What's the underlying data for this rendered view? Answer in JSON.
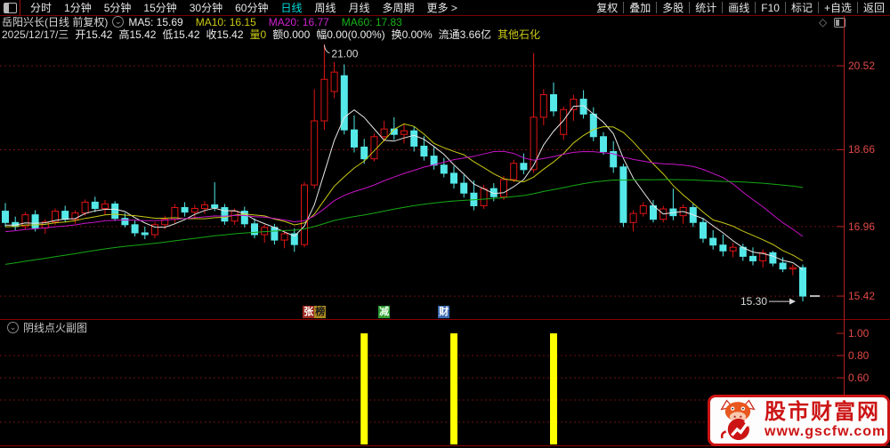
{
  "menubar": {
    "items": [
      "分时",
      "1分钟",
      "5分钟",
      "15分钟",
      "30分钟",
      "60分钟",
      "日线",
      "周线",
      "月线",
      "多周期",
      "更多 >"
    ],
    "active_item": "日线",
    "right_items": [
      "复权",
      "叠加",
      "多股",
      "统计",
      "画线",
      "F10",
      "标记",
      "+自选",
      "返回"
    ]
  },
  "info_bar": {
    "title": "岳阳兴长(日线 前复权)",
    "ma_legend": [
      {
        "label": "MA5: 15.69",
        "color": "#ececec"
      },
      {
        "label": "MA10: 16.15",
        "color": "#c9c914"
      },
      {
        "label": "MA20: 16.77",
        "color": "#d023d0"
      },
      {
        "label": "MA60: 17.83",
        "color": "#17b317"
      }
    ]
  },
  "quote_bar": {
    "fields": [
      {
        "text": "2025/12/17/三",
        "color": "#d9d9d9"
      },
      {
        "text": "开15.42",
        "color": "#ececec"
      },
      {
        "text": "高15.42",
        "color": "#ececec"
      },
      {
        "text": "低15.42",
        "color": "#ececec"
      },
      {
        "text": "收15.42",
        "color": "#ececec"
      },
      {
        "text": "量0",
        "color": "#c9c914"
      },
      {
        "text": "额0.000",
        "color": "#ececec"
      },
      {
        "text": "幅0.00(0.00%)",
        "color": "#ececec"
      },
      {
        "text": "换0.00%",
        "color": "#ececec"
      },
      {
        "text": "流通3.66亿",
        "color": "#ececec"
      },
      {
        "text": "其他石化",
        "color": "#c9c914"
      }
    ]
  },
  "chart_data": {
    "type": "candlestick",
    "price_ticks": [
      20.52,
      18.66,
      16.96,
      15.42
    ],
    "colors": {
      "up": "#e01414",
      "down": "#55e8e8",
      "grid": "#701010",
      "axis_text": "#e04848",
      "axis_line": "#b42222",
      "ma": [
        "#e8e8e8",
        "#c9c914",
        "#c714c7",
        "#15a815"
      ],
      "signal_bar": "#ffff00",
      "annotation": "#d8d8d8"
    },
    "ma_lines": [
      {
        "period": 5
      },
      {
        "period": 10
      },
      {
        "period": 20
      },
      {
        "period": 60
      }
    ],
    "ma_context_closes": [
      14.9,
      14.95,
      15.0,
      15.05,
      15.1,
      15.14,
      15.18,
      15.22,
      15.26,
      15.3,
      15.34,
      15.38,
      15.42,
      15.46,
      15.5,
      15.54,
      15.58,
      15.62,
      15.66,
      15.7,
      15.74,
      15.78,
      15.82,
      15.86,
      15.9,
      15.94,
      15.98,
      16.02,
      16.06,
      16.1,
      16.14,
      16.18,
      16.22,
      16.26,
      16.3,
      16.34,
      16.38,
      16.42,
      16.46,
      16.5,
      16.54,
      16.58,
      16.62,
      16.66,
      16.7,
      16.74,
      16.78,
      16.8,
      16.82,
      16.84,
      16.86,
      16.88,
      16.9,
      16.92,
      16.94,
      16.95,
      16.96,
      16.97,
      16.98,
      17.0
    ],
    "candles": [
      [
        17.3,
        17.48,
        16.95,
        17.05
      ],
      [
        17.05,
        17.18,
        16.88,
        16.96
      ],
      [
        16.96,
        17.28,
        16.9,
        17.22
      ],
      [
        17.22,
        17.32,
        16.85,
        16.93
      ],
      [
        16.93,
        17.12,
        16.8,
        17.06
      ],
      [
        17.06,
        17.36,
        17.0,
        17.3
      ],
      [
        17.3,
        17.42,
        17.06,
        17.12
      ],
      [
        17.12,
        17.32,
        17.02,
        17.26
      ],
      [
        17.26,
        17.56,
        17.2,
        17.5
      ],
      [
        17.5,
        17.62,
        17.28,
        17.36
      ],
      [
        17.36,
        17.55,
        17.22,
        17.46
      ],
      [
        17.46,
        17.52,
        17.08,
        17.14
      ],
      [
        17.14,
        17.26,
        16.94,
        17.0
      ],
      [
        17.0,
        17.1,
        16.74,
        16.82
      ],
      [
        16.82,
        16.96,
        16.68,
        16.78
      ],
      [
        16.78,
        17.06,
        16.7,
        17.0
      ],
      [
        17.0,
        17.2,
        16.9,
        17.12
      ],
      [
        17.12,
        17.46,
        17.04,
        17.38
      ],
      [
        17.38,
        17.5,
        17.18,
        17.28
      ],
      [
        17.28,
        17.44,
        17.14,
        17.36
      ],
      [
        17.36,
        17.52,
        17.24,
        17.44
      ],
      [
        17.44,
        17.94,
        17.3,
        17.38
      ],
      [
        17.38,
        17.46,
        17.0,
        17.08
      ],
      [
        17.08,
        17.36,
        17.0,
        17.3
      ],
      [
        17.3,
        17.4,
        16.94,
        17.02
      ],
      [
        17.02,
        17.14,
        16.7,
        16.78
      ],
      [
        16.78,
        17.0,
        16.6,
        16.94
      ],
      [
        16.94,
        17.02,
        16.56,
        16.66
      ],
      [
        16.66,
        16.88,
        16.48,
        16.8
      ],
      [
        16.8,
        16.92,
        16.4,
        16.56
      ],
      [
        16.56,
        17.95,
        16.5,
        17.88
      ],
      [
        17.88,
        20.0,
        17.8,
        19.3
      ],
      [
        19.3,
        21.0,
        19.1,
        20.22
      ],
      [
        19.95,
        20.6,
        19.8,
        20.38
      ],
      [
        20.3,
        20.55,
        19.0,
        19.1
      ],
      [
        19.1,
        19.42,
        18.6,
        18.72
      ],
      [
        18.72,
        18.9,
        18.35,
        18.46
      ],
      [
        18.46,
        19.02,
        18.4,
        18.95
      ],
      [
        18.95,
        19.3,
        18.85,
        19.12
      ],
      [
        19.12,
        19.38,
        18.88,
        19.0
      ],
      [
        19.0,
        19.22,
        18.8,
        19.08
      ],
      [
        19.08,
        19.18,
        18.62,
        18.74
      ],
      [
        18.74,
        18.96,
        18.42,
        18.52
      ],
      [
        18.52,
        18.72,
        18.22,
        18.32
      ],
      [
        18.32,
        18.48,
        18.05,
        18.14
      ],
      [
        18.14,
        18.3,
        17.8,
        17.92
      ],
      [
        17.92,
        18.1,
        17.6,
        17.7
      ],
      [
        17.7,
        17.98,
        17.32,
        17.42
      ],
      [
        17.42,
        17.88,
        17.35,
        17.8
      ],
      [
        17.8,
        17.92,
        17.52,
        17.62
      ],
      [
        17.62,
        18.08,
        17.55,
        18.0
      ],
      [
        18.0,
        18.44,
        17.94,
        18.36
      ],
      [
        18.36,
        18.58,
        18.12,
        18.22
      ],
      [
        18.22,
        20.8,
        18.15,
        19.38
      ],
      [
        19.38,
        20.0,
        19.2,
        19.88
      ],
      [
        19.88,
        20.15,
        19.4,
        19.52
      ],
      [
        19.0,
        19.62,
        18.88,
        19.55
      ],
      [
        19.55,
        19.88,
        19.3,
        19.78
      ],
      [
        19.78,
        19.98,
        19.35,
        19.45
      ],
      [
        19.45,
        19.6,
        18.85,
        18.95
      ],
      [
        18.95,
        19.05,
        18.55,
        18.62
      ],
      [
        18.62,
        18.85,
        18.15,
        18.28
      ],
      [
        18.28,
        18.35,
        16.95,
        17.05
      ],
      [
        17.05,
        17.32,
        16.85,
        17.25
      ],
      [
        17.25,
        17.5,
        17.18,
        17.42
      ],
      [
        17.42,
        17.55,
        17.05,
        17.12
      ],
      [
        17.12,
        17.42,
        17.05,
        17.35
      ],
      [
        17.35,
        17.8,
        17.1,
        17.2
      ],
      [
        17.2,
        17.45,
        17.02,
        17.38
      ],
      [
        17.38,
        17.48,
        16.95,
        17.05
      ],
      [
        17.05,
        17.15,
        16.6,
        16.7
      ],
      [
        16.7,
        16.88,
        16.45,
        16.55
      ],
      [
        16.55,
        16.78,
        16.3,
        16.42
      ],
      [
        16.42,
        16.6,
        16.28,
        16.5
      ],
      [
        16.5,
        16.58,
        16.2,
        16.3
      ],
      [
        16.3,
        16.5,
        16.1,
        16.2
      ],
      [
        16.2,
        16.45,
        16.05,
        16.38
      ],
      [
        16.38,
        16.42,
        16.08,
        16.15
      ],
      [
        16.15,
        16.28,
        15.95,
        16.02
      ],
      [
        16.02,
        16.12,
        15.88,
        16.05
      ],
      [
        16.05,
        16.12,
        15.3,
        15.42
      ]
    ],
    "annotations": {
      "high": {
        "text": "21.00",
        "candle_index": 32,
        "price": 21.0
      },
      "low": {
        "text": "15.30",
        "candle_index": 80,
        "price": 15.3
      },
      "last_close": 15.42
    },
    "event_badges": [
      {
        "candle_index": 31,
        "chars": [
          {
            "text": "张",
            "bg": "#9c2a20",
            "fg": "#ffffff"
          },
          {
            "text": "榜",
            "bg": "#a8871f",
            "fg": "#1a1a1a"
          }
        ]
      },
      {
        "candle_index": 38,
        "chars": [
          {
            "text": "减",
            "bg": "#2e9930",
            "fg": "#eaffea"
          }
        ]
      },
      {
        "candle_index": 44,
        "chars": [
          {
            "text": "财",
            "bg": "#3868b0",
            "fg": "#ffffff"
          }
        ]
      }
    ]
  },
  "subchart": {
    "title": "阴线点火副图",
    "axis_ticks": [
      {
        "value": 1.0,
        "label": "1.00"
      },
      {
        "value": 0.8,
        "label": "0.80"
      },
      {
        "value": 0.6,
        "label": "0.60"
      }
    ],
    "grid_values": [
      0.8,
      0.6,
      0.4,
      0.2
    ],
    "signal_indices": [
      36,
      45,
      55
    ],
    "bar_value": 1.0
  },
  "watermark": {
    "line1": "股市财富网",
    "line2": "www.gscfw.com"
  }
}
